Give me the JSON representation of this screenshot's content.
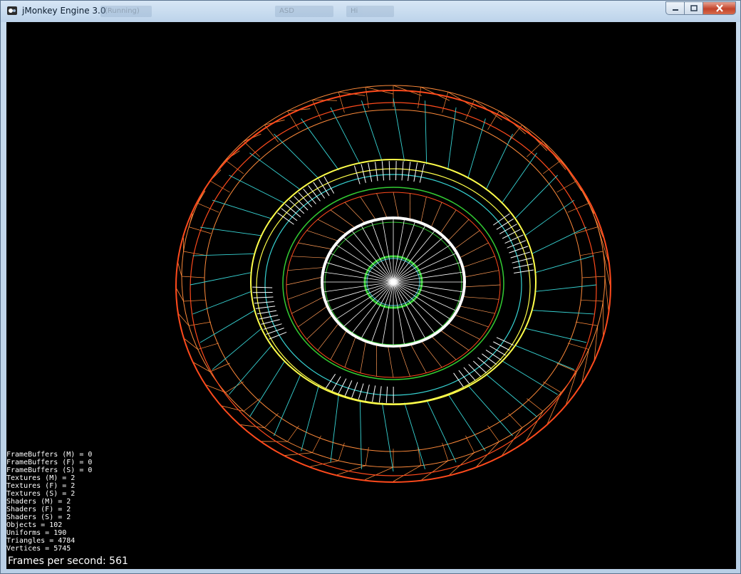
{
  "window": {
    "title": "jMonkey Engine 3.0",
    "background_tabs": [
      "(Running)",
      "ASD",
      "Hi"
    ],
    "controls": {
      "minimize_icon": "minimize-icon",
      "maximize_icon": "maximize-icon",
      "close_icon": "close-icon"
    }
  },
  "render": {
    "stats": [
      "FrameBuffers (M) = 0",
      "FrameBuffers (F) = 0",
      "FrameBuffers (S) = 0",
      "Textures (M) = 2",
      "Textures (F) = 2",
      "Textures (S) = 2",
      "Shaders (M) = 2",
      "Shaders (F) = 2",
      "Shaders (S) = 2",
      "Objects = 102",
      "Uniforms = 190",
      "Triangles = 4784",
      "Vertices = 5745"
    ],
    "fps_label": "Frames per second: 561"
  },
  "colors": {
    "outer_ring": "#ff4a1c",
    "outer_ring_inner": "#ff8a3a",
    "spokes_cyan": "#37d4d4",
    "yellow_ring": "#ffff4a",
    "green_ring": "#33cc33",
    "white_wire": "#ffffff",
    "background": "#000000"
  }
}
